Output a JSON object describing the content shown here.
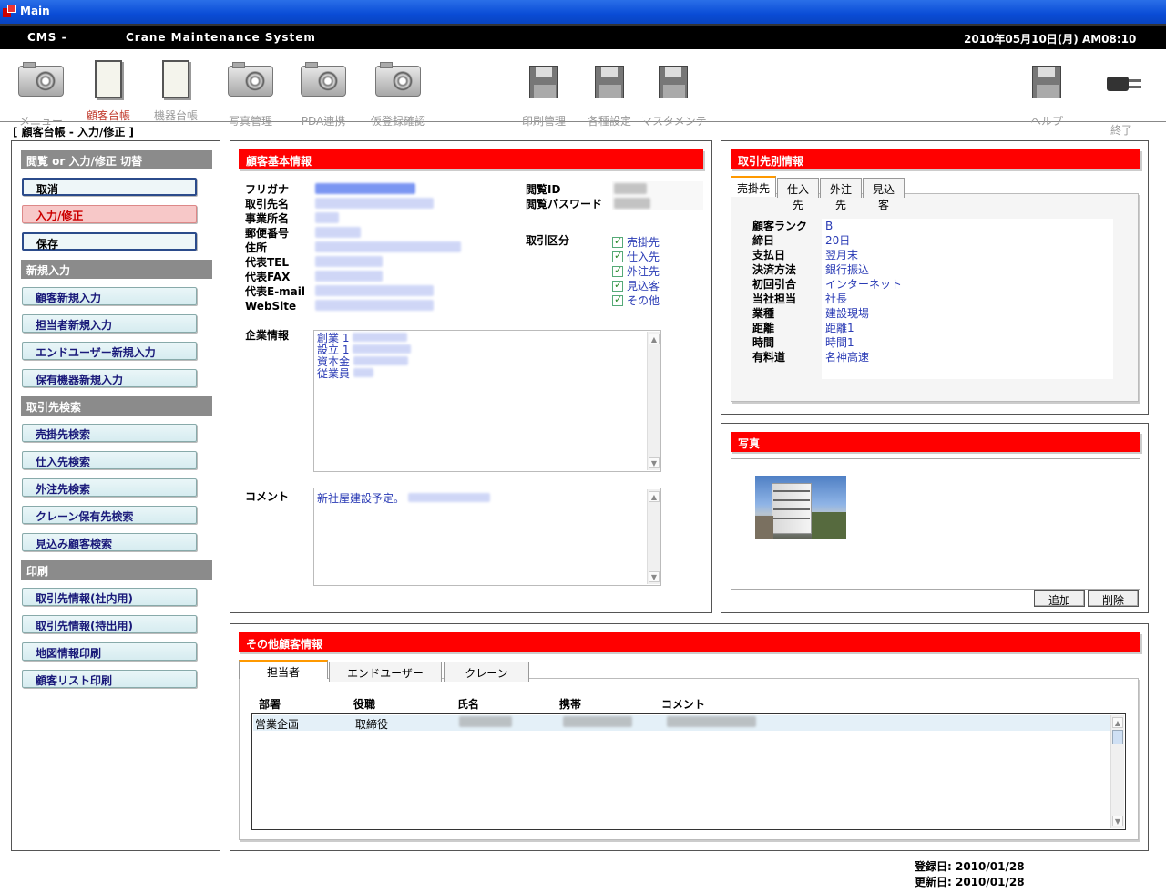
{
  "window": {
    "title": "Main"
  },
  "header": {
    "app_short": "CMS -",
    "app_name": "Crane Maintenance System",
    "datetime": "2010年05月10日(月) AM08:10"
  },
  "toolbar": [
    {
      "label": "メニュー",
      "icon": "camera-icon"
    },
    {
      "label": "顧客台帳",
      "icon": "ledger-icon",
      "active": true
    },
    {
      "label": "機器台帳",
      "icon": "ledger-icon"
    },
    {
      "label": "写真管理",
      "icon": "camera-icon"
    },
    {
      "label": "PDA連携",
      "icon": "camera-icon"
    },
    {
      "label": "仮登録確認",
      "icon": "camera-icon"
    },
    {
      "label": "印刷管理",
      "icon": "floppy-icon"
    },
    {
      "label": "各種設定",
      "icon": "floppy-icon"
    },
    {
      "label": "マスタメンテ",
      "icon": "floppy-icon"
    },
    {
      "label": "ヘルプ",
      "icon": "floppy-icon"
    },
    {
      "label": "終了",
      "icon": "plug-icon"
    }
  ],
  "breadcrumb": "[ 顧客台帳 - 入力/修正 ]",
  "left": {
    "sections": [
      "閲覧 or 入力/修正 切替",
      "新規入力",
      "取引先検索",
      "印刷"
    ],
    "mode_buttons": [
      "取消",
      "入力/修正",
      "保存"
    ],
    "new_buttons": [
      "顧客新規入力",
      "担当者新規入力",
      "エンドユーザー新規入力",
      "保有機器新規入力"
    ],
    "search_buttons": [
      "売掛先検索",
      "仕入先検索",
      "外注先検索",
      "クレーン保有先検索",
      "見込み顧客検索"
    ],
    "print_buttons": [
      "取引先情報(社内用)",
      "取引先情報(持出用)",
      "地図情報印刷",
      "顧客リスト印刷"
    ]
  },
  "basic": {
    "title": "顧客基本情報",
    "labels": [
      "フリガナ",
      "取引先名",
      "事業所名",
      "郵便番号",
      "住所",
      "代表TEL",
      "代表FAX",
      "代表E-mail",
      "WebSite"
    ],
    "view_id_label": "閲覧ID",
    "view_pw_label": "閲覧パスワード",
    "class_label": "取引区分",
    "classes": [
      "売掛先",
      "仕入先",
      "外注先",
      "見込客",
      "その他"
    ],
    "company_label": "企業情報",
    "company_lines": [
      "創業 1",
      "設立 1",
      "資本金",
      "従業員"
    ],
    "comment_label": "コメント",
    "comment_text": "新社屋建設予定。"
  },
  "trade": {
    "title": "取引先別情報",
    "tabs": [
      "売掛先",
      "仕入先",
      "外注先",
      "見込客"
    ],
    "rows": [
      {
        "k": "顧客ランク",
        "v": "B"
      },
      {
        "k": "締日",
        "v": "20日"
      },
      {
        "k": "支払日",
        "v": "翌月末"
      },
      {
        "k": "決済方法",
        "v": "銀行振込"
      },
      {
        "k": "初回引合",
        "v": "インターネット"
      },
      {
        "k": "当社担当",
        "v": "社長"
      },
      {
        "k": "業種",
        "v": "建設現場"
      },
      {
        "k": "距離",
        "v": "距離1"
      },
      {
        "k": "時間",
        "v": "時間1"
      },
      {
        "k": "有料道",
        "v": "名神高速"
      }
    ]
  },
  "photo": {
    "title": "写真",
    "add": "追加",
    "delete": "削除"
  },
  "other": {
    "title": "その他顧客情報",
    "tabs": [
      "担当者",
      "エンドユーザー",
      "クレーン"
    ],
    "columns": [
      "部署",
      "役職",
      "氏名",
      "携帯",
      "コメント"
    ],
    "row": {
      "dept": "営業企画",
      "role": "取締役"
    }
  },
  "footer": {
    "registered": "登録日: 2010/01/28",
    "updated": "更新日: 2010/01/28"
  },
  "colors": {
    "accent_red": "#ff0000",
    "title_blue": "#0a4cd6",
    "value_blue": "#2a3bb5"
  }
}
